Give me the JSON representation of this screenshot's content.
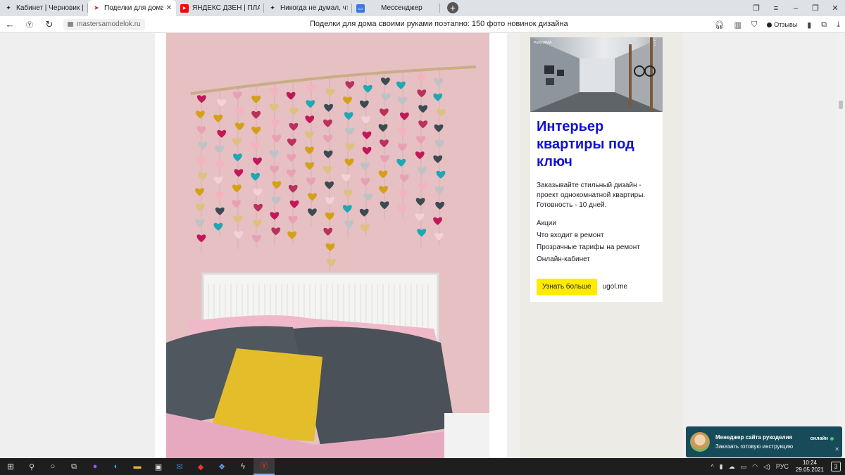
{
  "tabs": [
    {
      "label": "Кабинет | Черновик | Янд",
      "icon": "sparkle-icon",
      "icon_color": "#222222",
      "active": false
    },
    {
      "label": "Поделки для дома сво",
      "icon": "site-arrow-icon",
      "icon_color": "#d8232a",
      "active": true,
      "close": "✕"
    },
    {
      "label": "ЯНДЕКС ДЗЕН | ПЛАН ПУ",
      "icon": "youtube-icon",
      "icon_color": "#ff0000",
      "active": false
    },
    {
      "label": "Никогда не думал, что мо",
      "icon": "sparkle-icon",
      "icon_color": "#222222",
      "active": false
    },
    {
      "label": "Мессенджер",
      "icon": "messenger-icon",
      "icon_color": "#3b78e7",
      "active": false
    }
  ],
  "newtab_symbol": "+",
  "window_controls": {
    "collections": "❐",
    "menu": "≡",
    "minimize": "–",
    "restore": "❐",
    "close": "✕"
  },
  "address": {
    "url": "mastersamodelok.ru",
    "page_title": "Поделки для дома своими руками поэтапно: 150 фото новинок дизайна",
    "reviews_label": "Отзывы"
  },
  "ad": {
    "badge": "РЕКЛАМА",
    "title": "Интерьер квартиры под ключ",
    "description": "Заказывайте стильный дизайн - проект однокомнатной квартиры. Готовность - 10 дней.",
    "links": [
      "Акции",
      "Что входит в ремонт",
      "Прозрачные тарифы на ремонт",
      "Онлайн-кабинет"
    ],
    "button": "Узнать больше",
    "domain": "ugol.me",
    "accent": "#1010d8",
    "button_color": "#ffea00"
  },
  "chat": {
    "title": "Менеджер сайта рукоделия",
    "subtitle": "Заказать готовую инструкцию",
    "status": "онлайн",
    "close": "✕"
  },
  "taskbar": {
    "language": "РУС",
    "time": "10:24",
    "date": "29.05.2021",
    "notifications": "3"
  },
  "hearts": {
    "colors": [
      "#e8a0b4",
      "#c2185b",
      "#f5b3c0",
      "#3b4b52",
      "#d4a017",
      "#bfc2c4",
      "#e0c080",
      "#1fa7b5",
      "#b9315d",
      "#f4d0d8"
    ]
  }
}
